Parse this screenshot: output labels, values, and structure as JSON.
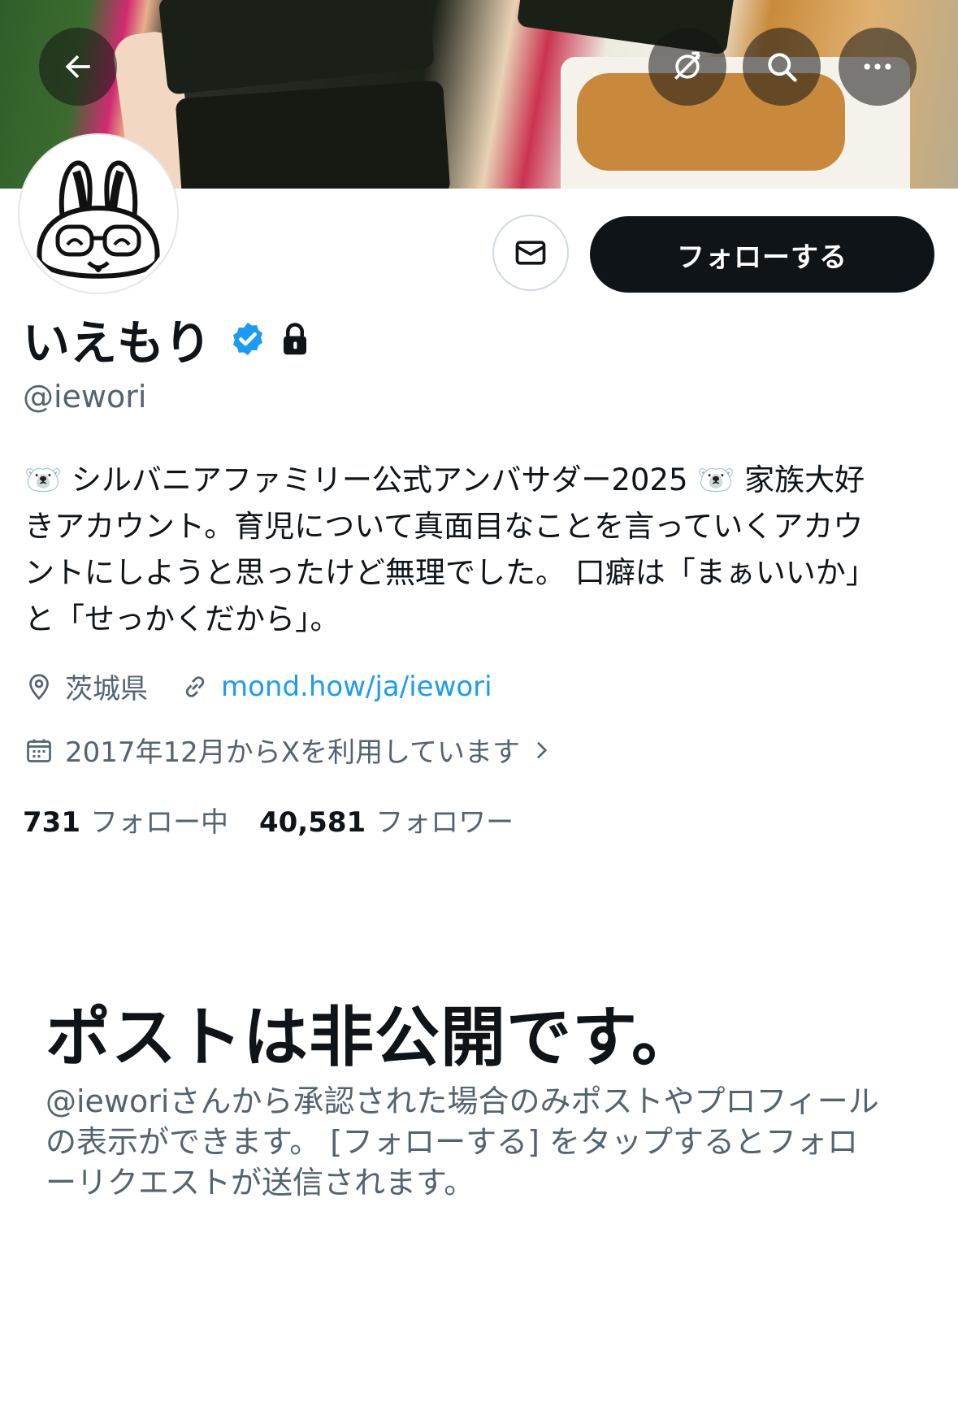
{
  "profile": {
    "display_name": "いえもり",
    "handle": "@iewori",
    "bio_lines": [
      "🐻‍❄️ シルバニアファミリー公式アンバサダー2025 🐻‍❄️ 家族大好",
      "きアカウント。育児について真面目なことを言っていくアカウ",
      "ントにしようと思ったけど無理でした。 口癖は「まぁいいか」",
      "と「せっかくだから」。"
    ],
    "location": "茨城県",
    "website": "mond.how/ja/iewori",
    "joined": "2017年12月からXを利用しています",
    "following_count": "731",
    "following_label": "フォロー中",
    "followers_count": "40,581",
    "followers_label": "フォロワー"
  },
  "actions": {
    "follow_label": "フォローする"
  },
  "private_notice": {
    "title": "ポストは非公開です。",
    "desc_lines": [
      "@ieworiさんから承認された場合のみポストやプロフィール",
      "の表示ができます。 [フォローする] をタップするとフォロ",
      "ーリクエストが送信されます。"
    ]
  },
  "icons": {
    "back": "arrow-left-icon",
    "translate": "translate-off-icon",
    "search": "search-icon",
    "more": "more-icon",
    "message": "envelope-icon",
    "verified": "verified-badge-icon",
    "protected": "lock-icon",
    "location": "location-pin-icon",
    "link": "link-icon",
    "calendar": "calendar-icon",
    "chevron": "chevron-right-icon"
  },
  "colors": {
    "accent": "#1d9bf0",
    "text": "#0f1419",
    "secondary": "#536471",
    "button_dark": "#0f1419"
  }
}
